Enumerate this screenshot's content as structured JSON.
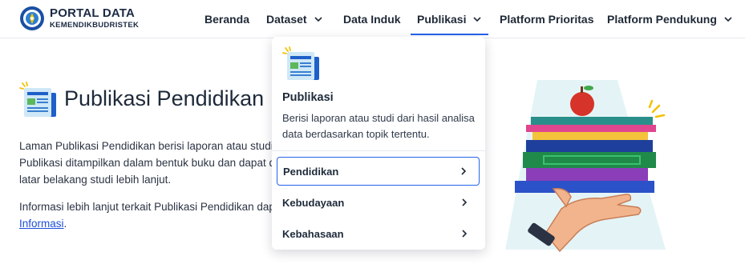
{
  "header": {
    "logo": {
      "title": "PORTAL DATA",
      "subtitle": "KEMENDIKBUDRISTEK"
    },
    "nav": [
      {
        "label": "Beranda",
        "dropdown": false
      },
      {
        "label": "Dataset",
        "dropdown": true
      },
      {
        "label": "Data Induk",
        "dropdown": false
      },
      {
        "label": "Publikasi",
        "dropdown": true,
        "active": true
      },
      {
        "label": "Platform Prioritas",
        "dropdown": false
      },
      {
        "label": "Platform Pendukung",
        "dropdown": true
      }
    ]
  },
  "page": {
    "title": "Publikasi Pendidikan",
    "paragraph1": [
      "Laman Publikasi Pendidikan berisi laporan atau studi",
      "Publikasi ditampilkan dalam bentuk buku dan dapat d",
      "latar belakang studi lebih lanjut."
    ],
    "paragraph2_line1": "Informasi lebih lanjut terkait Publikasi Pendidikan dap",
    "paragraph2_link": "Informasi",
    "paragraph2_tail": "."
  },
  "dropdown": {
    "title": "Publikasi",
    "description": "Berisi laporan atau studi dari hasil analisa data berdasarkan topik tertentu.",
    "items": [
      {
        "label": "Pendidikan",
        "focused": true
      },
      {
        "label": "Kebudayaan",
        "focused": false
      },
      {
        "label": "Kebahasaan",
        "focused": false
      }
    ]
  },
  "icons": {
    "logo": "tut-wuri-handayani-emblem",
    "publication": "newspaper-icon",
    "chevron": "chevron-down-icon",
    "arrow": "chevron-right-icon"
  },
  "colors": {
    "accent": "#2563eb",
    "text": "#1e2a3a",
    "link": "#1d4ed8"
  }
}
